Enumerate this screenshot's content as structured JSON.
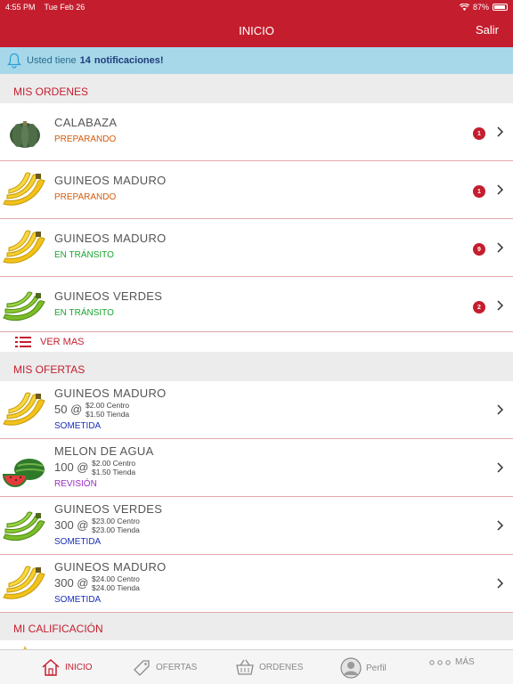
{
  "status_bar": {
    "time": "4:55 PM",
    "date": "Tue Feb 26",
    "battery": "87%"
  },
  "nav": {
    "title": "INICIO",
    "logout_label": "Salir"
  },
  "notification": {
    "prefix": "Usted tiene",
    "count": "14",
    "suffix": "notificaciones!"
  },
  "orders_section": {
    "title": "MIS ORDENES",
    "items": [
      {
        "name": "CALABAZA",
        "status": "PREPARANDO",
        "badge": "1",
        "icon": "pumpkin-icon"
      },
      {
        "name": "GUINEOS MADURO",
        "status": "PREPARANDO",
        "badge": "1",
        "icon": "ripe-banana-icon"
      },
      {
        "name": "GUINEOS MADURO",
        "status": "EN TRÁNSITO",
        "badge": "9",
        "icon": "ripe-banana-icon"
      },
      {
        "name": "GUINEOS VERDES",
        "status": "EN TRÁNSITO",
        "badge": "2",
        "icon": "green-banana-icon"
      }
    ],
    "see_more_label": "VER MAS"
  },
  "offers_section": {
    "title": "MIS OFERTAS",
    "items": [
      {
        "name": "GUINEOS MADURO",
        "qty": "50 @",
        "price_center": "$2.00 Centro",
        "price_store": "$1.50 Tienda",
        "status": "SOMETIDA",
        "icon": "ripe-banana-icon"
      },
      {
        "name": "MELON DE AGUA",
        "qty": "100 @",
        "price_center": "$2.00 Centro",
        "price_store": "$1.50 Tienda",
        "status": "REVISIÓN",
        "icon": "watermelon-icon"
      },
      {
        "name": "GUINEOS VERDES",
        "qty": "300 @",
        "price_center": "$23.00 Centro",
        "price_store": "$23.00 Tienda",
        "status": "SOMETIDA",
        "icon": "green-banana-icon"
      },
      {
        "name": "GUINEOS MADURO",
        "qty": "300 @",
        "price_center": "$24.00 Centro",
        "price_store": "$24.00 Tienda",
        "status": "SOMETIDA",
        "icon": "ripe-banana-icon"
      }
    ]
  },
  "rating_section": {
    "title": "MI CALIFICACIÓN"
  },
  "tab_bar": {
    "tabs": [
      {
        "label": "INICIO",
        "icon": "home-icon",
        "active": true
      },
      {
        "label": "OFERTAS",
        "icon": "tag-icon",
        "active": false
      },
      {
        "label": "ORDENES",
        "icon": "basket-icon",
        "active": false
      },
      {
        "label": "Perfil",
        "icon": "profile-icon",
        "active": false
      },
      {
        "label": "MÁS",
        "icon": "more-icon",
        "active": false
      }
    ]
  },
  "colors": {
    "brand_red": "#c41e2e",
    "notification_bg": "#a6d8ea",
    "status_preparing": "#d35b0b",
    "status_transit": "#1aa32f",
    "status_submitted": "#1a2fb8",
    "status_review": "#9a2fc4"
  }
}
